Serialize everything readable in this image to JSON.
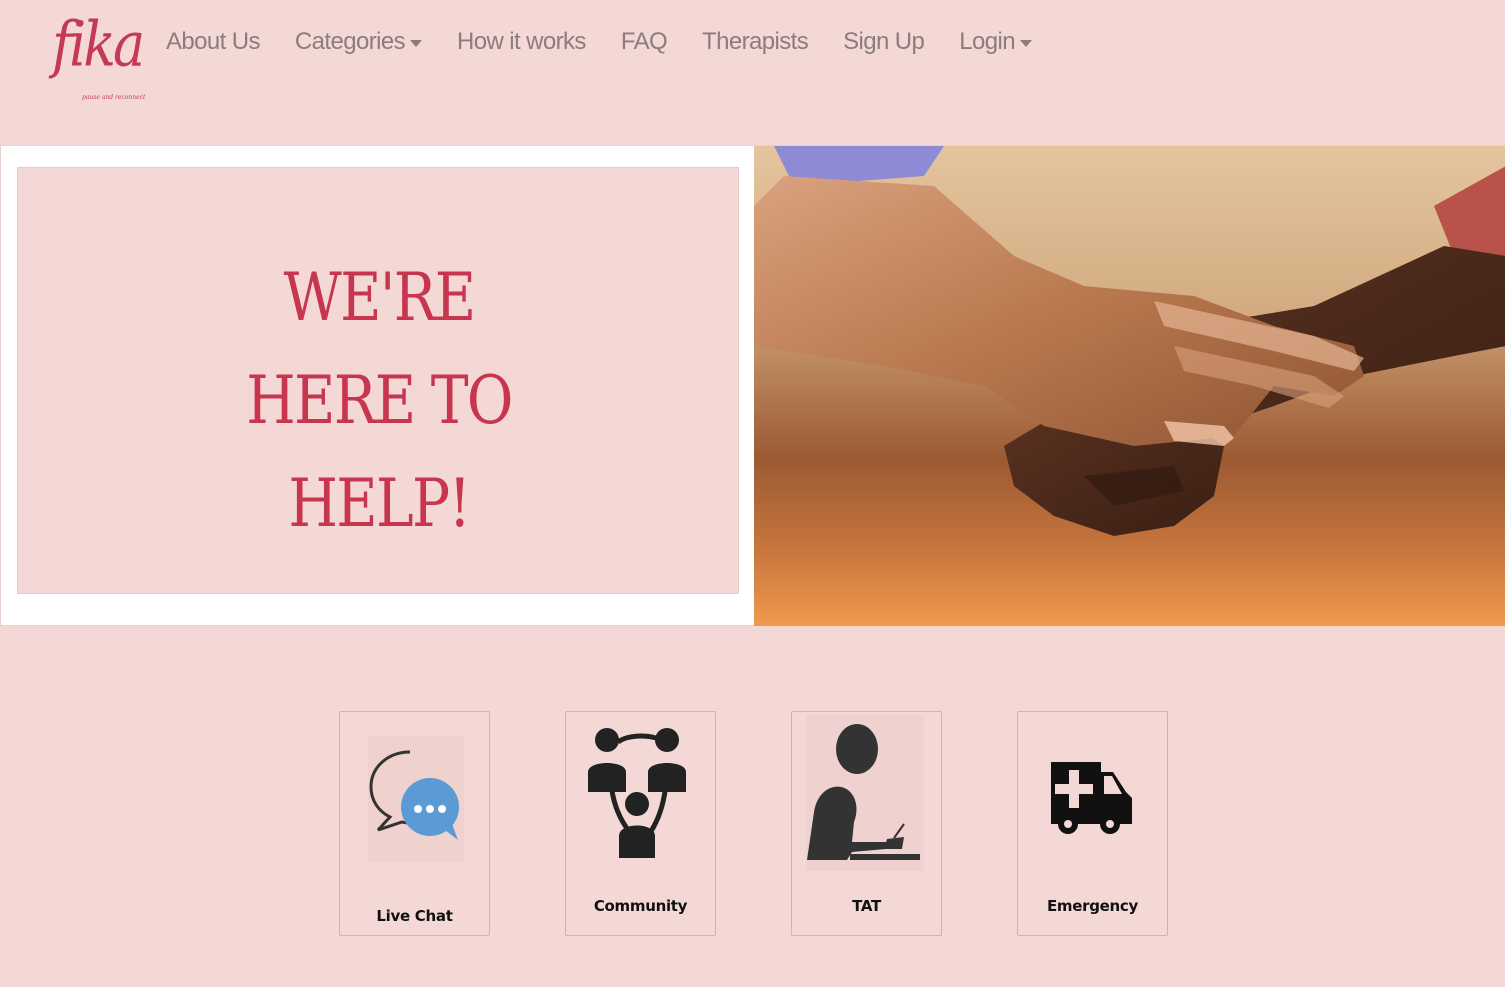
{
  "brand": {
    "name": "fika",
    "tagline": "pause and reconnect"
  },
  "nav": {
    "items": [
      {
        "label": "About Us",
        "dropdown": false
      },
      {
        "label": "Categories",
        "dropdown": true
      },
      {
        "label": "How it works",
        "dropdown": false
      },
      {
        "label": "FAQ",
        "dropdown": false
      },
      {
        "label": "Therapists",
        "dropdown": false
      },
      {
        "label": "Sign Up",
        "dropdown": false
      },
      {
        "label": "Login",
        "dropdown": true
      }
    ]
  },
  "hero": {
    "heading_lines": [
      "WE'RE",
      "HERE TO",
      "HELP!"
    ],
    "image": "clasped-hands-photo"
  },
  "services": [
    {
      "label": "Live Chat",
      "icon": "chat-bubbles-icon"
    },
    {
      "label": "Community",
      "icon": "community-icon"
    },
    {
      "label": "TAT",
      "icon": "person-writing-icon"
    },
    {
      "label": "Emergency",
      "icon": "ambulance-icon"
    }
  ],
  "colors": {
    "background": "#f4d8d5",
    "accent": "#c8354f",
    "nav_text": "#8a7d7c",
    "chat_blue": "#5b9bd5"
  }
}
